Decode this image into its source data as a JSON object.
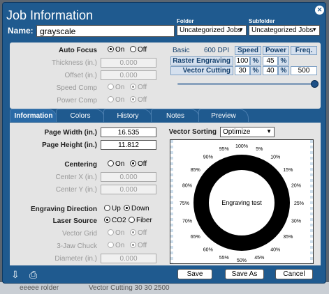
{
  "window": {
    "title": "Job Information"
  },
  "name": {
    "label": "Name:",
    "value": "grayscale"
  },
  "folder": {
    "label": "Folder",
    "value": "Uncategorized Jobs"
  },
  "subfolder": {
    "label": "Subfolder",
    "value": "Uncategorized Jobs"
  },
  "top": {
    "auto_focus": {
      "label": "Auto Focus",
      "on": "On",
      "off": "Off",
      "selected": "On"
    },
    "thickness": {
      "label": "Thickness (in.)",
      "value": "0.000"
    },
    "offset": {
      "label": "Offset (in.)",
      "value": "0.000"
    },
    "speed_comp": {
      "label": "Speed Comp",
      "on": "On",
      "off": "Off",
      "selected": "Off"
    },
    "power_comp": {
      "label": "Power Comp",
      "on": "On",
      "off": "Off",
      "selected": "Off"
    },
    "mode": "Basic",
    "dpi": "600 DPI",
    "table": {
      "headers": [
        "Speed",
        "Power",
        "Freq."
      ],
      "unit": "%",
      "rows": [
        {
          "label": "Raster Engraving",
          "speed": "100",
          "power": "45",
          "freq": ""
        },
        {
          "label": "Vector Cutting",
          "speed": "30",
          "power": "40",
          "freq": "500"
        }
      ]
    },
    "slider_level": 1.0
  },
  "tabs": [
    "Information",
    "Colors",
    "History",
    "Notes",
    "Preview"
  ],
  "info": {
    "page_width": {
      "label": "Page Width (in.)",
      "value": "16.535"
    },
    "page_height": {
      "label": "Page Height (in.)",
      "value": "11.812"
    },
    "centering": {
      "label": "Centering",
      "on": "On",
      "off": "Off",
      "selected": "Off"
    },
    "center_x": {
      "label": "Center X (in.)",
      "value": "0.000"
    },
    "center_y": {
      "label": "Center Y (in.)",
      "value": "0.000"
    },
    "engraving_direction": {
      "label": "Engraving Direction",
      "up": "Up",
      "down": "Down",
      "selected": "Down"
    },
    "laser_source": {
      "label": "Laser Source",
      "co2": "CO2",
      "fiber": "Fiber",
      "selected": "CO2"
    },
    "vector_grid": {
      "label": "Vector Grid",
      "on": "On",
      "off": "Off",
      "selected": "Off"
    },
    "three_jaw": {
      "label": "3-Jaw Chuck",
      "on": "On",
      "off": "Off",
      "selected": "Off"
    },
    "diameter": {
      "label": "Diameter (in.)",
      "value": "0.000"
    },
    "vector_sorting": {
      "label": "Vector Sorting",
      "value": "Optimize"
    }
  },
  "preview": {
    "center_text": "Engraving test",
    "ring_labels": [
      "100%",
      "5%",
      "10%",
      "15%",
      "20%",
      "25%",
      "30%",
      "35%",
      "40%",
      "45%",
      "50%",
      "55%",
      "60%",
      "65%",
      "70%",
      "75%",
      "80%",
      "85%",
      "90%",
      "95%"
    ]
  },
  "buttons": {
    "save": "Save",
    "save_as": "Save As",
    "cancel": "Cancel"
  },
  "icons": {
    "import": "import-icon",
    "print": "printer-icon",
    "close": "close-icon"
  },
  "background_strip": {
    "left": "eeeee rolder",
    "right": "Vector Cutting   30   30   2500"
  }
}
